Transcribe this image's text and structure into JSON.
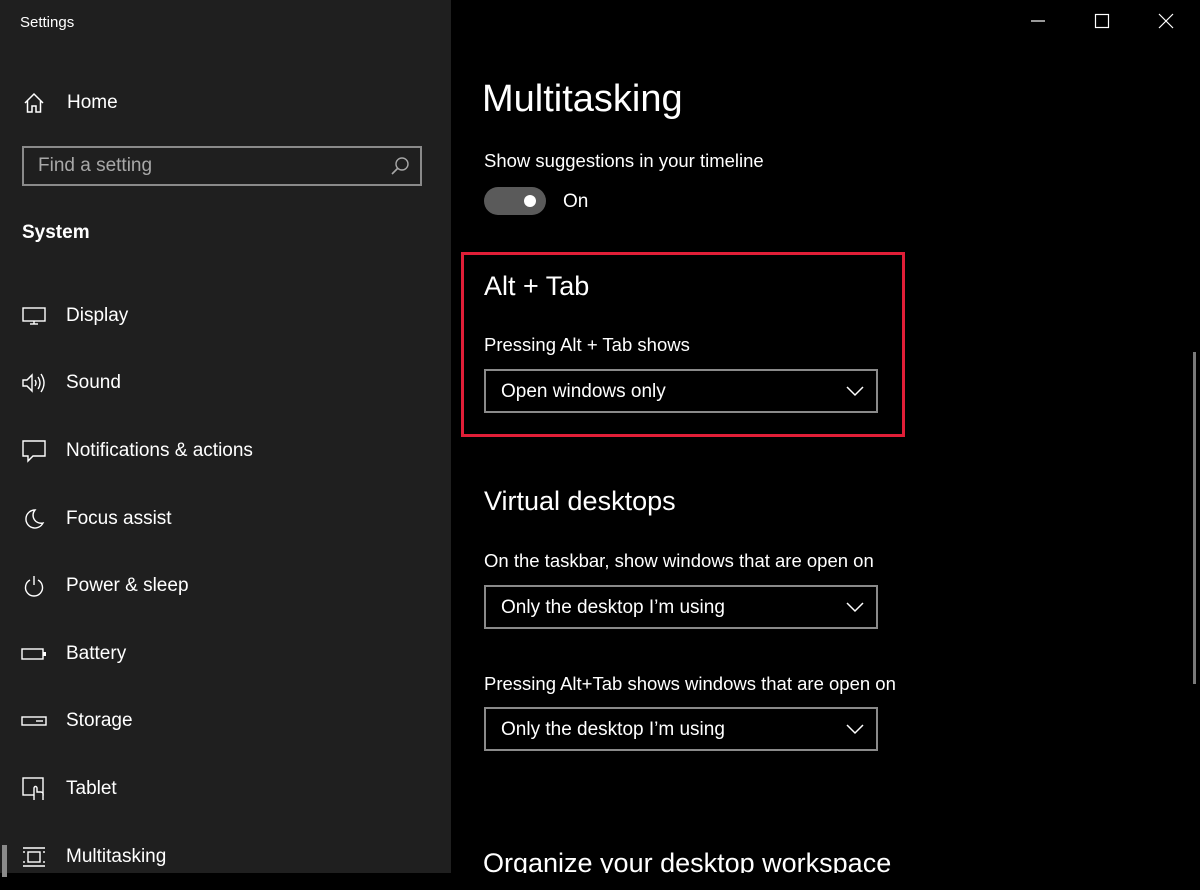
{
  "window": {
    "title": "Settings"
  },
  "sidebar": {
    "home_label": "Home",
    "search": {
      "placeholder": "Find a setting",
      "value": ""
    },
    "section_label": "System",
    "items": [
      {
        "label": "Display",
        "icon": "monitor-icon"
      },
      {
        "label": "Sound",
        "icon": "speaker-icon"
      },
      {
        "label": "Notifications & actions",
        "icon": "notification-icon"
      },
      {
        "label": "Focus assist",
        "icon": "moon-icon"
      },
      {
        "label": "Power & sleep",
        "icon": "power-icon"
      },
      {
        "label": "Battery",
        "icon": "battery-icon"
      },
      {
        "label": "Storage",
        "icon": "storage-icon"
      },
      {
        "label": "Tablet",
        "icon": "tablet-icon"
      },
      {
        "label": "Multitasking",
        "icon": "multitasking-icon",
        "selected": true
      }
    ]
  },
  "main": {
    "title": "Multitasking",
    "timeline": {
      "label": "Show suggestions in your timeline",
      "state": "On",
      "enabled": true
    },
    "alt_tab": {
      "heading": "Alt + Tab",
      "label": "Pressing Alt + Tab shows",
      "selected": "Open windows only",
      "highlight_color": "#e01e37"
    },
    "virtual_desktops": {
      "heading": "Virtual desktops",
      "taskbar_label": "On the taskbar, show windows that are open on",
      "taskbar_selected": "Only the desktop I’m using",
      "alttab_label": "Pressing Alt+Tab shows windows that are open on",
      "alttab_selected": "Only the desktop I’m using"
    },
    "next_heading": "Organize your desktop workspace"
  },
  "colors": {
    "sidebar_bg": "#1f1f1f",
    "main_bg": "#000000",
    "border": "#8a8a8a"
  }
}
